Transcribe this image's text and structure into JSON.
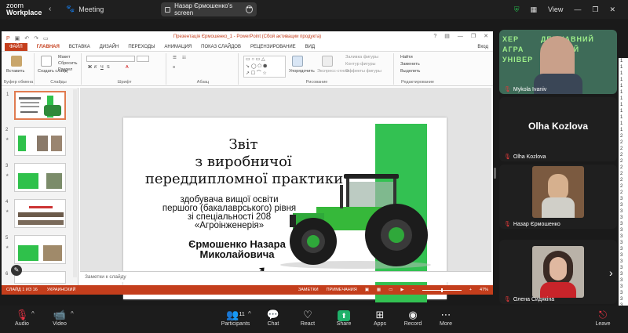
{
  "zoom": {
    "brand_top": "zoom",
    "brand_bottom": "Workplace",
    "meeting_label": "Meeting",
    "share_label": "Назар Єрмошенко's screen",
    "view_label": "View",
    "colors": {
      "bar": "#1f1f1f",
      "share_green": "#1fb16a",
      "accent_red": "#c43e1c"
    }
  },
  "ppt": {
    "title": "Презентація Єрмошенко_1 - PowerPoint (Сбой активации продукта)",
    "tabs": [
      "ФАЙЛ",
      "ГЛАВНАЯ",
      "ВСТАВКА",
      "ДИЗАЙН",
      "ПЕРЕХОДЫ",
      "АНИМАЦИЯ",
      "ПОКАЗ СЛАЙДОВ",
      "РЕЦЕНЗИРОВАНИЕ",
      "ВИД"
    ],
    "sign_in": "Вход",
    "ribbon": {
      "paste": "Вставить",
      "create_slide": "Создать слайд",
      "layout": "Макет",
      "reset": "Сбросить",
      "section": "Раздел",
      "clipboard": "Буфер обмена",
      "slides_group": "Слайды",
      "font_group": "Шрифт",
      "paragraph_group": "Абзац",
      "arrange": "Упорядочить",
      "express_styles": "Экспресс-стили",
      "fill": "Заливка фигуры",
      "outline": "Контур фигуры",
      "effects": "Эффекты фигуры",
      "drawing_group": "Рисование",
      "find": "Найти",
      "replace": "Заменить",
      "select": "Выделить",
      "editing_group": "Редактирование"
    },
    "thumb_numbers": [
      "1",
      "2",
      "3",
      "4",
      "5",
      "6"
    ],
    "slide": {
      "title_lines": [
        "Звіт",
        "з виробничої",
        "переддипломної практики"
      ],
      "subtitle_lines": [
        "здобувача вищої освіти",
        "першого (бакалаврського) рівня",
        "зі  спеціальності 208",
        "«Агроінженерія»"
      ],
      "name_lines": [
        "Єрмошенко Назара",
        "Миколайовича"
      ]
    },
    "notes_placeholder": "Заметки к слайду",
    "status": {
      "slide_info": "СЛАЙД 1 ИЗ 16",
      "language": "УКРАИНСКИЙ",
      "notes_btn": "ЗАМЕТКИ",
      "comments_btn": "ПРИМЕЧАНИЯ",
      "zoom_level": "47%"
    }
  },
  "participants": [
    {
      "name": "Mykola Ivaniv"
    },
    {
      "name": "Olha Kozlova",
      "big_name": "Olha Kozlova"
    },
    {
      "name": "Назар Єрмошенко"
    },
    {
      "name": "Олена Сидякіна"
    }
  ],
  "sidecol_numbers": [
    "1",
    "1",
    "1",
    "1",
    "1",
    "1",
    "1",
    "1",
    "1",
    "1",
    "1",
    "1",
    "2",
    "2",
    "2",
    "2",
    "2",
    "2",
    "2",
    "2",
    "2",
    "2",
    "3",
    "3",
    "3",
    "3",
    "3",
    "3",
    "3",
    "3",
    "3",
    "3",
    "3",
    "3",
    "3",
    "3",
    "3",
    "3",
    "3",
    "3",
    "3"
  ],
  "toolbar": {
    "audio": "Audio",
    "video": "Video",
    "participants": "Participants",
    "participants_count": "11",
    "chat": "Chat",
    "react": "React",
    "share": "Share",
    "apps": "Apps",
    "record": "Record",
    "more": "More",
    "leave": "Leave"
  }
}
